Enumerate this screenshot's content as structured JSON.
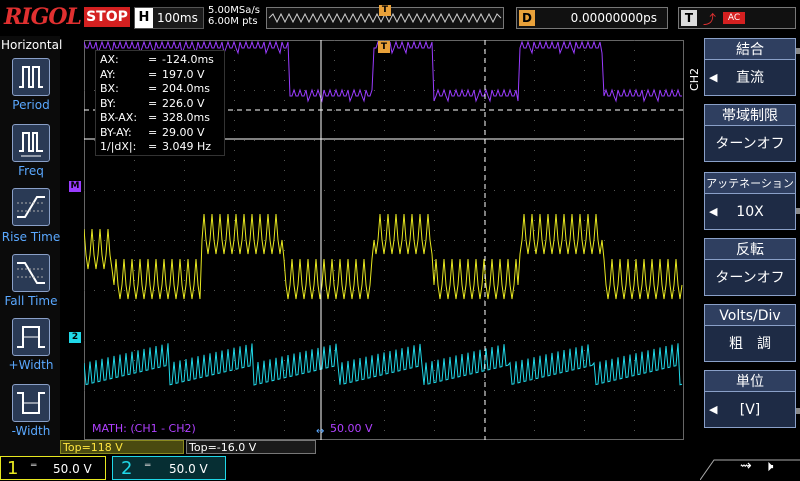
{
  "header": {
    "brand": "RIGOL",
    "run_state": "STOP",
    "timebase_label": "H",
    "timebase_value": "100ms",
    "sample_rate": "5.00MSa/s",
    "memory_depth": "6.00M pts",
    "trigger_marker": "T",
    "delay_label": "D",
    "delay_value": "0.00000000ps",
    "trigger_label": "T",
    "trigger_mode": "AC"
  },
  "left_panel": {
    "title": "Horizontal",
    "items": [
      {
        "label": "Period"
      },
      {
        "label": "Freq"
      },
      {
        "label": "Rise Time"
      },
      {
        "label": "Fall Time"
      },
      {
        "label": "+Width"
      },
      {
        "label": "-Width"
      }
    ]
  },
  "cursor_table": {
    "rows": [
      {
        "key": "AX:",
        "value": "-124.0ms"
      },
      {
        "key": "AY:",
        "value": "197.0 V"
      },
      {
        "key": "BX:",
        "value": "204.0ms"
      },
      {
        "key": "BY:",
        "value": "226.0 V"
      },
      {
        "key": "BX-AX:",
        "value": "328.0ms"
      },
      {
        "key": "BY-AY:",
        "value": "29.00 V"
      },
      {
        "key": "1/|dX|:",
        "value": "3.049 Hz"
      }
    ]
  },
  "channel_markers": {
    "math": "M",
    "ch2": "2"
  },
  "math": {
    "label": "MATH: (CH1 - CH2)",
    "scale": "50.00 V"
  },
  "offsets": {
    "ch1_top": "Top=118 V",
    "ch2_top": "Top=-16.0 V"
  },
  "menu": {
    "channel_tag": "CH2",
    "items": [
      {
        "title": "結合",
        "value": "直流"
      },
      {
        "title": "帯域制限",
        "value": "ターンオフ"
      },
      {
        "title": "アッテネーション",
        "value": "10X"
      },
      {
        "title": "反転",
        "value": "ターンオフ"
      },
      {
        "title": "Volts/Div",
        "value": "粗　調"
      },
      {
        "title": "単位",
        "value": "[V]"
      }
    ]
  },
  "channels": {
    "ch1": {
      "number": "1",
      "coupling": "═",
      "scale": "50.0 V",
      "color": "#e8e820"
    },
    "ch2": {
      "number": "2",
      "coupling": "═",
      "scale": "50.0 V",
      "color": "#20d8e8"
    },
    "math_color": "#9a3cff"
  }
}
